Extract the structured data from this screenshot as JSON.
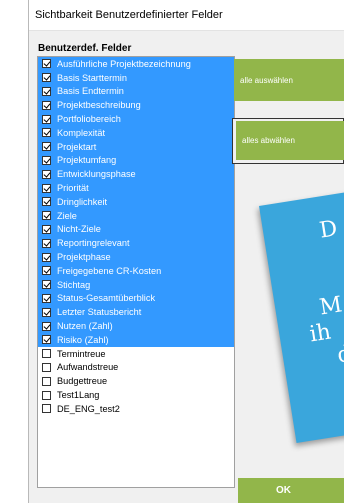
{
  "window": {
    "title": "Sichtbarkeit Benutzerdefinierter Felder"
  },
  "list": {
    "heading": "Benutzerdef. Felder",
    "items": [
      {
        "label": "Ausführliche Projektbezeichnung",
        "checked": true,
        "selected": true
      },
      {
        "label": "Basis Starttermin",
        "checked": true,
        "selected": true
      },
      {
        "label": "Basis Endtermin",
        "checked": true,
        "selected": true
      },
      {
        "label": "Projektbeschreibung",
        "checked": true,
        "selected": true
      },
      {
        "label": "Portfoliobereich",
        "checked": true,
        "selected": true
      },
      {
        "label": "Komplexität",
        "checked": true,
        "selected": true
      },
      {
        "label": "Projektart",
        "checked": true,
        "selected": true
      },
      {
        "label": "Projektumfang",
        "checked": true,
        "selected": true
      },
      {
        "label": "Entwicklungsphase",
        "checked": true,
        "selected": true
      },
      {
        "label": "Priorität",
        "checked": true,
        "selected": true
      },
      {
        "label": "Dringlichkeit",
        "checked": true,
        "selected": true
      },
      {
        "label": "Ziele",
        "checked": true,
        "selected": true
      },
      {
        "label": "Nicht-Ziele",
        "checked": true,
        "selected": true
      },
      {
        "label": "Reportingrelevant",
        "checked": true,
        "selected": true
      },
      {
        "label": "Projektphase",
        "checked": true,
        "selected": true
      },
      {
        "label": "Freigegebene CR-Kosten",
        "checked": true,
        "selected": true
      },
      {
        "label": "Stichtag",
        "checked": true,
        "selected": true
      },
      {
        "label": "Status-Gesamtüberblick",
        "checked": true,
        "selected": true
      },
      {
        "label": "Letzter Statusbericht",
        "checked": true,
        "selected": true
      },
      {
        "label": "Nutzen (Zahl)",
        "checked": true,
        "selected": true
      },
      {
        "label": "Risiko (Zahl)",
        "checked": true,
        "selected": true
      },
      {
        "label": "Termintreue",
        "checked": false,
        "selected": false
      },
      {
        "label": "Aufwandstreue",
        "checked": false,
        "selected": false
      },
      {
        "label": "Budgettreue",
        "checked": false,
        "selected": false
      },
      {
        "label": "Test1Lang",
        "checked": false,
        "selected": false
      },
      {
        "label": "DE_ENG_test2",
        "checked": false,
        "selected": false
      }
    ]
  },
  "buttons": {
    "select_all": "alle auswählen",
    "deselect_all": "alles abwählen",
    "ok": "OK"
  },
  "note": {
    "lines": [
      "D",
      "M",
      "ih",
      "d"
    ]
  },
  "colors": {
    "selection": "#3399ff",
    "button": "#92b64a",
    "note": "#3aa6dc"
  }
}
